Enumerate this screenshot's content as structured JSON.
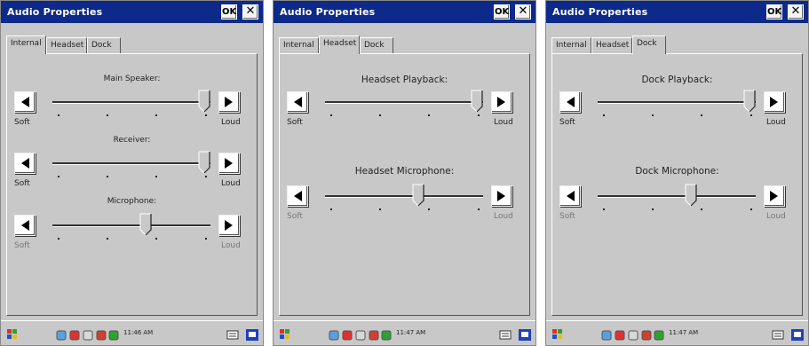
{
  "screens": [
    {
      "title": "Audio Properties",
      "ok": "OK",
      "close": "✕",
      "tabs": [
        "Internal",
        "Headset",
        "Dock"
      ],
      "active_tab": "Internal",
      "sliders": [
        {
          "label": "Main Speaker:",
          "soft": "Soft",
          "loud": "Loud",
          "level": 1.0
        },
        {
          "label": "Receiver:",
          "soft": "Soft",
          "loud": "Loud",
          "level": 1.0
        },
        {
          "label": "Microphone:",
          "soft": "Soft",
          "loud": "Loud",
          "level": 0.6
        }
      ],
      "clock": "11:46 AM"
    },
    {
      "title": "Audio Properties",
      "ok": "OK",
      "close": "✕",
      "tabs": [
        "Internal",
        "Headset",
        "Dock"
      ],
      "active_tab": "Headset",
      "sliders": [
        {
          "label": "Headset Playback:",
          "soft": "Soft",
          "loud": "Loud",
          "level": 1.0
        },
        {
          "label": "Headset Microphone:",
          "soft": "Soft",
          "loud": "Loud",
          "level": 0.6
        }
      ],
      "clock": "11:47 AM"
    },
    {
      "title": "Audio Properties",
      "ok": "OK",
      "close": "✕",
      "tabs": [
        "Internal",
        "Headset",
        "Dock"
      ],
      "active_tab": "Dock",
      "sliders": [
        {
          "label": "Dock Playback:",
          "soft": "Soft",
          "loud": "Loud",
          "level": 1.0
        },
        {
          "label": "Dock Microphone:",
          "soft": "Soft",
          "loud": "Loud",
          "level": 0.6
        }
      ],
      "clock": "11:47 AM"
    }
  ],
  "colors": {
    "titlebar": "#0d2a8a",
    "window": "#c8c8c8"
  },
  "icons": [
    "start-icon",
    "network-icon",
    "battery-icon",
    "keyboard-icon",
    "desktop-icon"
  ]
}
